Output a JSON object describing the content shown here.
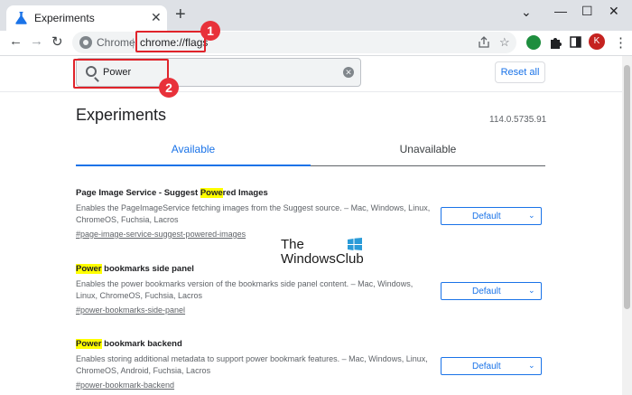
{
  "window": {
    "tab_title": "Experiments",
    "new_tab": "+",
    "tab_close": "✕",
    "minimize": "—",
    "maximize": "☐",
    "close": "✕",
    "collapse": "⌄"
  },
  "toolbar": {
    "back": "←",
    "forward": "→",
    "reload": "↻",
    "omnibox_label": "Chrome",
    "omnibox_separator": "|",
    "url": "chrome://flags",
    "share_icon": "share-icon",
    "star_icon": "star-icon",
    "avatar_letter": "K",
    "menu": "⋮"
  },
  "search": {
    "value": "Power",
    "clear": "✕"
  },
  "reset_label": "Reset all",
  "annotations": {
    "badge1": "1",
    "badge2": "2"
  },
  "page": {
    "title": "Experiments",
    "version": "114.0.5735.91",
    "tab_available": "Available",
    "tab_unavailable": "Unavailable"
  },
  "flags": [
    {
      "title_pre": "Page Image Service - Suggest ",
      "title_hl": "Powe",
      "title_post": "red Images",
      "desc": "Enables the PageImageService fetching images from the Suggest source. – Mac, Windows, Linux, ChromeOS, Fuchsia, Lacros",
      "link": "#page-image-service-suggest-powered-images",
      "value": "Default"
    },
    {
      "title_pre": "",
      "title_hl": "Power",
      "title_post": " bookmarks side panel",
      "desc": "Enables the power bookmarks version of the bookmarks side panel content. – Mac, Windows, Linux, ChromeOS, Fuchsia, Lacros",
      "link": "#power-bookmarks-side-panel",
      "value": "Default"
    },
    {
      "title_pre": "",
      "title_hl": "Power",
      "title_post": " bookmark backend",
      "desc": "Enables storing additional metadata to support power bookmark features. – Mac, Windows, Linux, ChromeOS, Android, Fuchsia, Lacros",
      "link": "#power-bookmark-backend",
      "value": "Default"
    }
  ],
  "watermark": {
    "line1": "The",
    "line2": "WindowsClub"
  },
  "colors": {
    "accent": "#1a73e8",
    "highlight": "#ffff00",
    "annotation_red": "#e0232a"
  }
}
